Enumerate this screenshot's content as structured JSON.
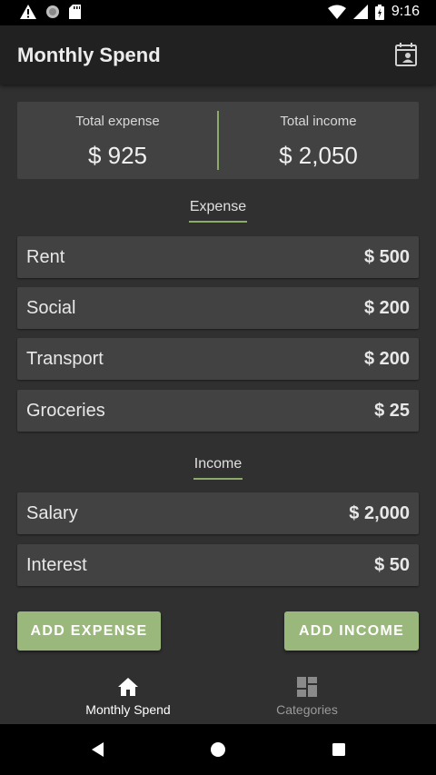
{
  "status_bar": {
    "time": "9:16",
    "icons": [
      "warning-icon",
      "circle-icon",
      "sd-card-icon",
      "wifi-icon",
      "signal-icon",
      "battery-icon"
    ]
  },
  "app_bar": {
    "title": "Monthly Spend",
    "action_icon": "calendar-person-icon"
  },
  "totals": {
    "expense_label": "Total expense",
    "expense_value": "$ 925",
    "income_label": "Total income",
    "income_value": "$ 2,050"
  },
  "expense_section": {
    "title": "Expense",
    "items": [
      {
        "label": "Rent",
        "amount": "$ 500"
      },
      {
        "label": "Social",
        "amount": "$ 200"
      },
      {
        "label": "Transport",
        "amount": "$ 200"
      },
      {
        "label": "Groceries",
        "amount": "$ 25"
      }
    ]
  },
  "income_section": {
    "title": "Income",
    "items": [
      {
        "label": "Salary",
        "amount": "$ 2,000"
      },
      {
        "label": "Interest",
        "amount": "$ 50"
      }
    ]
  },
  "buttons": {
    "add_expense": "ADD EXPENSE",
    "add_income": "ADD INCOME"
  },
  "bottom_nav": {
    "items": [
      {
        "label": "Monthly Spend",
        "icon": "home-icon",
        "active": true
      },
      {
        "label": "Categories",
        "icon": "dashboard-icon",
        "active": false
      }
    ]
  },
  "colors": {
    "accent": "#9ab87b",
    "divider": "#8cab6a",
    "background": "#303030",
    "card": "#424242",
    "app_bar": "#212121"
  }
}
